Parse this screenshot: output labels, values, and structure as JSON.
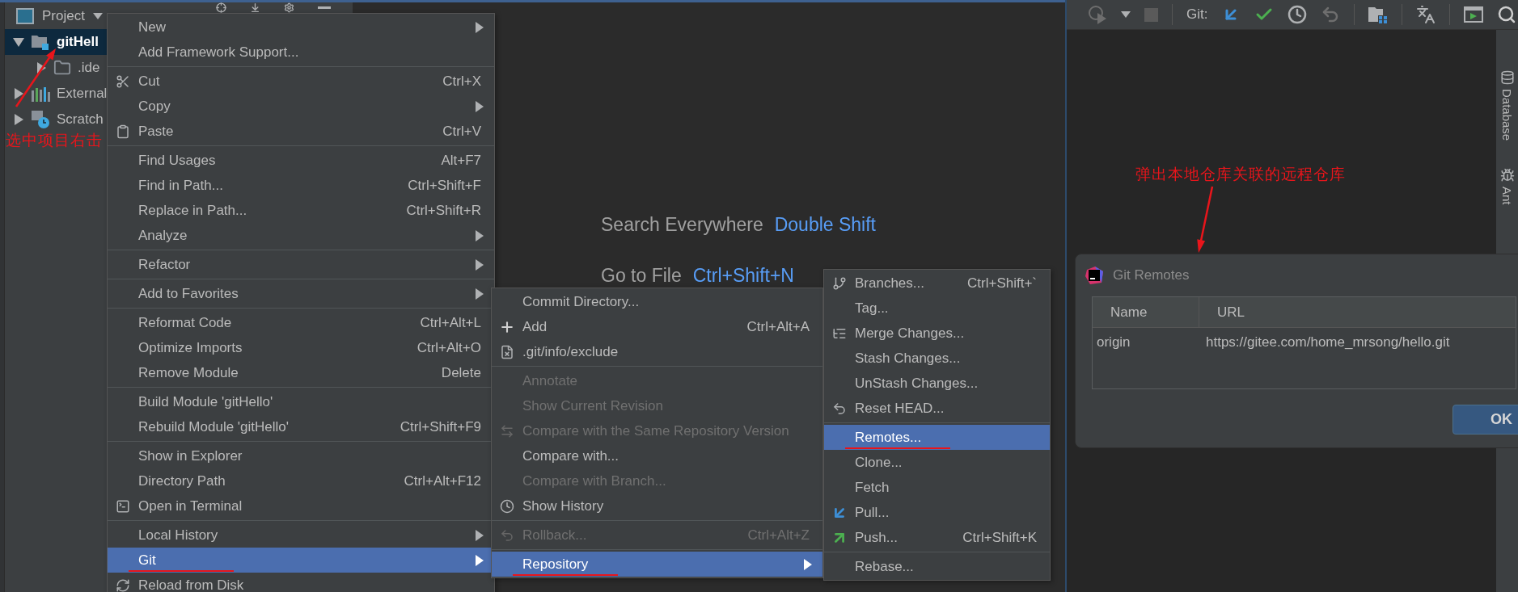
{
  "project_panel": {
    "title": "Project",
    "tree": [
      {
        "label": "gitHell",
        "expanded": true,
        "selected": true,
        "children": [
          {
            "label": ".ide",
            "expanded": false,
            "selected": false
          }
        ]
      },
      {
        "label": "External",
        "expanded": false,
        "selected": false
      },
      {
        "label": "Scratch",
        "expanded": false,
        "selected": false
      }
    ]
  },
  "editor_hints": [
    {
      "action": "Search Everywhere",
      "shortcut": "Double Shift"
    },
    {
      "action": "Go to File",
      "shortcut": "Ctrl+Shift+N"
    }
  ],
  "toolbar": {
    "label": "Git:"
  },
  "side_strip": [
    "Database",
    "Ant"
  ],
  "annotations": [
    {
      "text": "选中项目右击"
    },
    {
      "text": "弹出本地仓库关联的远程仓库"
    }
  ],
  "context_menu": {
    "groups": [
      [
        {
          "label": "New",
          "submenu": true,
          "selected": false,
          "marked": false
        },
        {
          "label": "Add Framework Support...",
          "submenu": false,
          "selected": false,
          "marked": false
        }
      ],
      [
        {
          "label": "Cut",
          "shortcut": "Ctrl+X",
          "submenu": false,
          "selected": false,
          "marked": false
        },
        {
          "label": "Copy",
          "submenu": true,
          "selected": false,
          "marked": false
        },
        {
          "label": "Paste",
          "shortcut": "Ctrl+V",
          "submenu": false,
          "selected": false,
          "marked": false
        }
      ],
      [
        {
          "label": "Find Usages",
          "shortcut": "Alt+F7",
          "submenu": false,
          "selected": false,
          "marked": false
        },
        {
          "label": "Find in Path...",
          "shortcut": "Ctrl+Shift+F",
          "submenu": false,
          "selected": false,
          "marked": false
        },
        {
          "label": "Replace in Path...",
          "shortcut": "Ctrl+Shift+R",
          "submenu": false,
          "selected": false,
          "marked": false
        },
        {
          "label": "Analyze",
          "submenu": true,
          "selected": false,
          "marked": false
        }
      ],
      [
        {
          "label": "Refactor",
          "submenu": true,
          "selected": false,
          "marked": false
        }
      ],
      [
        {
          "label": "Add to Favorites",
          "submenu": true,
          "selected": false,
          "marked": false
        }
      ],
      [
        {
          "label": "Reformat Code",
          "shortcut": "Ctrl+Alt+L",
          "submenu": false,
          "selected": false,
          "marked": false
        },
        {
          "label": "Optimize Imports",
          "shortcut": "Ctrl+Alt+O",
          "submenu": false,
          "selected": false,
          "marked": false
        },
        {
          "label": "Remove Module",
          "shortcut": "Delete",
          "submenu": false,
          "selected": false,
          "marked": false
        }
      ],
      [
        {
          "label": "Build Module 'gitHello'",
          "submenu": false,
          "selected": false,
          "marked": false
        },
        {
          "label": "Rebuild Module 'gitHello'",
          "shortcut": "Ctrl+Shift+F9",
          "submenu": false,
          "selected": false,
          "marked": false
        }
      ],
      [
        {
          "label": "Show in Explorer",
          "submenu": false,
          "selected": false,
          "marked": false
        },
        {
          "label": "Directory Path",
          "shortcut": "Ctrl+Alt+F12",
          "submenu": false,
          "selected": false,
          "marked": false
        },
        {
          "label": "Open in Terminal",
          "submenu": false,
          "selected": false,
          "marked": false
        }
      ],
      [
        {
          "label": "Local History",
          "submenu": true,
          "selected": false,
          "marked": false
        },
        {
          "label": "Git",
          "submenu": true,
          "selected": true,
          "marked": true
        },
        {
          "label": "Reload from Disk",
          "submenu": false,
          "selected": false
        }
      ]
    ]
  },
  "git_menu": {
    "groups": [
      [
        {
          "label": "Commit Directory...",
          "submenu": false,
          "selected": false,
          "marked": false,
          "disabled": false
        },
        {
          "label": "Add",
          "shortcut": "Ctrl+Alt+A",
          "submenu": false,
          "selected": false,
          "marked": false,
          "disabled": false
        },
        {
          "label": ".git/info/exclude",
          "submenu": false,
          "selected": false,
          "marked": false,
          "disabled": false
        }
      ],
      [
        {
          "label": "Annotate",
          "submenu": false,
          "selected": false,
          "marked": false,
          "disabled": true
        },
        {
          "label": "Show Current Revision",
          "submenu": false,
          "selected": false,
          "marked": false,
          "disabled": true
        },
        {
          "label": "Compare with the Same Repository Version",
          "submenu": false,
          "selected": false,
          "marked": false,
          "disabled": true
        },
        {
          "label": "Compare with...",
          "submenu": false,
          "selected": false,
          "marked": false,
          "disabled": false
        },
        {
          "label": "Compare with Branch...",
          "submenu": false,
          "selected": false,
          "marked": false,
          "disabled": true
        },
        {
          "label": "Show History",
          "submenu": false,
          "selected": false,
          "marked": false,
          "disabled": false
        }
      ],
      [
        {
          "label": "Rollback...",
          "shortcut": "Ctrl+Alt+Z",
          "submenu": false,
          "selected": false,
          "marked": false,
          "disabled": true
        }
      ],
      [
        {
          "label": "Repository",
          "submenu": true,
          "selected": true,
          "marked": true,
          "disabled": false
        }
      ]
    ]
  },
  "repository_menu": {
    "groups": [
      [
        {
          "label": "Branches...",
          "shortcut": "Ctrl+Shift+`",
          "submenu": false,
          "selected": false,
          "marked": false
        },
        {
          "label": "Tag...",
          "submenu": false,
          "selected": false,
          "marked": false
        },
        {
          "label": "Merge Changes...",
          "submenu": false,
          "selected": false,
          "marked": false
        },
        {
          "label": "Stash Changes...",
          "submenu": false,
          "selected": false,
          "marked": false
        },
        {
          "label": "UnStash Changes...",
          "submenu": false,
          "selected": false,
          "marked": false
        },
        {
          "label": "Reset HEAD...",
          "submenu": false,
          "selected": false,
          "marked": false
        }
      ],
      [
        {
          "label": "Remotes...",
          "submenu": false,
          "selected": true,
          "marked": true
        },
        {
          "label": "Clone...",
          "submenu": false,
          "selected": false,
          "marked": false
        },
        {
          "label": "Fetch",
          "submenu": false,
          "selected": false,
          "marked": false
        },
        {
          "label": "Pull...",
          "submenu": false,
          "selected": false,
          "marked": false
        },
        {
          "label": "Push...",
          "shortcut": "Ctrl+Shift+K",
          "submenu": false,
          "selected": false,
          "marked": false
        }
      ],
      [
        {
          "label": "Rebase...",
          "submenu": false,
          "selected": false,
          "marked": false
        }
      ]
    ]
  },
  "dialog": {
    "title": "Git Remotes",
    "columns": [
      "Name",
      "URL"
    ],
    "rows": [
      [
        "origin",
        "https://gitee.com/home_mrsong/hello.git"
      ]
    ],
    "button": "OK"
  }
}
